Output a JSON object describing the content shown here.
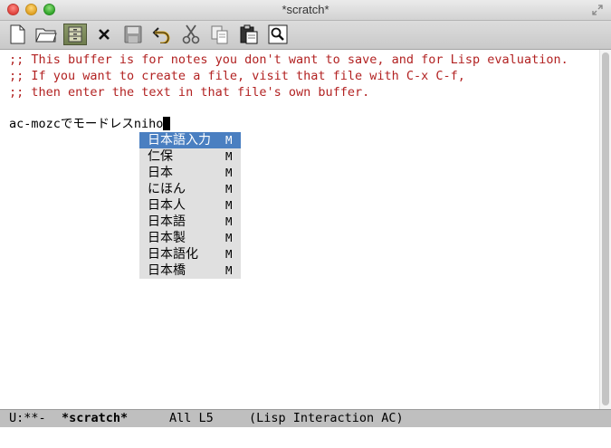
{
  "window": {
    "title": "*scratch*"
  },
  "toolbar": {
    "buttons": [
      {
        "name": "new-file",
        "icon": "new-file-icon"
      },
      {
        "name": "open-file",
        "icon": "folder-icon"
      },
      {
        "name": "open-directory",
        "icon": "file-cabinet-icon"
      },
      {
        "name": "close-buffer",
        "icon": "close-icon"
      },
      {
        "name": "save",
        "icon": "save-icon"
      },
      {
        "name": "undo",
        "icon": "undo-icon"
      },
      {
        "name": "cut",
        "icon": "scissors-icon"
      },
      {
        "name": "copy",
        "icon": "copy-icon"
      },
      {
        "name": "paste",
        "icon": "paste-icon"
      },
      {
        "name": "search",
        "icon": "search-icon"
      }
    ]
  },
  "buffer": {
    "comments": [
      ";; This buffer is for notes you don't want to save, and for Lisp evaluation.",
      ";; If you want to create a file, visit that file with C-x C-f,",
      ";; then enter the text in that file's own buffer."
    ],
    "input_line": "ac-mozcでモードレスniho"
  },
  "completion": {
    "items": [
      {
        "candidate": "日本語入力",
        "mark": "M",
        "selected": true
      },
      {
        "candidate": "仁保",
        "mark": "M"
      },
      {
        "candidate": "日本",
        "mark": "M"
      },
      {
        "candidate": "にほん",
        "mark": "M"
      },
      {
        "candidate": "日本人",
        "mark": "M"
      },
      {
        "candidate": "日本語",
        "mark": "M"
      },
      {
        "candidate": "日本製",
        "mark": "M"
      },
      {
        "candidate": "日本語化",
        "mark": "M"
      },
      {
        "candidate": "日本橋",
        "mark": "M"
      }
    ]
  },
  "modeline": {
    "status": "U:**-",
    "buffer_name": "*scratch*",
    "position": "All L5",
    "mode": "(Lisp Interaction AC)"
  },
  "colors": {
    "comment": "#b22222",
    "selection": "#4a7fc1",
    "popup_bg": "#e0e0e0",
    "modeline_bg": "#bfbfbf"
  }
}
